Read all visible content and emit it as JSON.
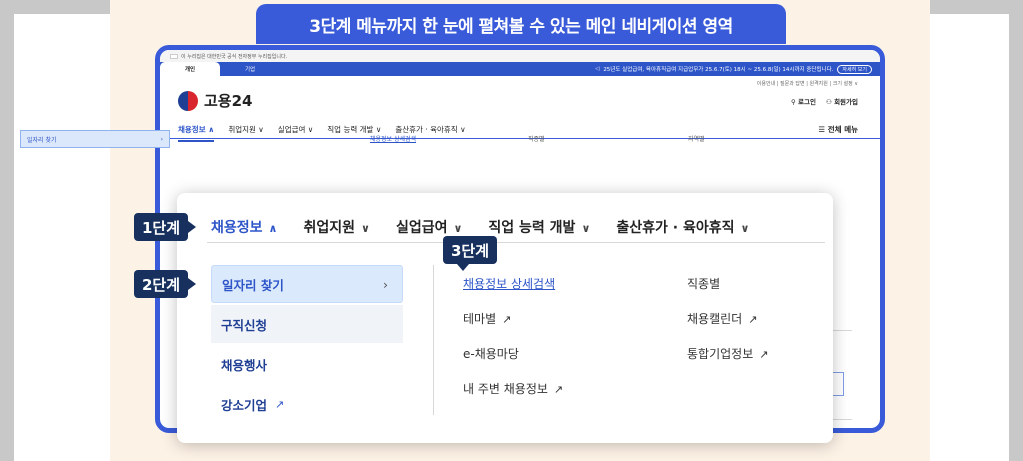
{
  "banner_title": "3단계 메뉴까지 한 눈에 펼쳐볼 수 있는 메인 네비게이션 영역",
  "site": {
    "gov_notice": "이 누리집은 대한민국 공식 전자정부 누리집입니다.",
    "tabs": [
      "개인",
      "기업"
    ],
    "notice": "25년도 실업급여, 육아휴직급여 지급업무가 25.6.7(토) 18시 ~ 25.6.8(일) 14시까지 중단됩니다.",
    "notice_button": "자세히 보기",
    "logo_text": "고용24",
    "util_links": "이용안내 | 질문과 답변 | 원격지원 | 크기 설정 ∨",
    "login": "로그인",
    "signup": "회원가입",
    "all_menu": "전체 메뉴",
    "mini_nav": [
      "채용정보 ∧",
      "취업지원 ∨",
      "실업급여 ∨",
      "직업 능력 개발 ∨",
      "출산휴가 · 육아휴직 ∨"
    ],
    "mini_side_item": "일자리 찾기",
    "mini_links": [
      "채용정보 상세검색",
      "직종별",
      "지역별"
    ]
  },
  "zoom": {
    "nav": [
      {
        "label": "채용정보",
        "caret": "∧"
      },
      {
        "label": "취업지원",
        "caret": "∨"
      },
      {
        "label": "실업급여",
        "caret": "∨"
      },
      {
        "label": "직업 능력 개발",
        "caret": "∨"
      },
      {
        "label": "출산휴가 · 육아휴직",
        "caret": "∨"
      }
    ],
    "left_items": [
      "일자리 찾기",
      "구직신청",
      "채용행사",
      "강소기업"
    ],
    "left_chevron": "›",
    "col1": [
      "채용정보 상세검색",
      "테마별",
      "e-채용마당",
      "내 주변 채용정보"
    ],
    "col2": [
      "직종별",
      "채용캘린더",
      "통합기업정보"
    ],
    "external_glyph": "↗"
  },
  "steps": {
    "step1": "1단계",
    "step2": "2단계",
    "step3": "3단계"
  },
  "colors": {
    "accent": "#3a5bd9",
    "badge": "#17305e",
    "active_blue": "#2d55c8"
  }
}
